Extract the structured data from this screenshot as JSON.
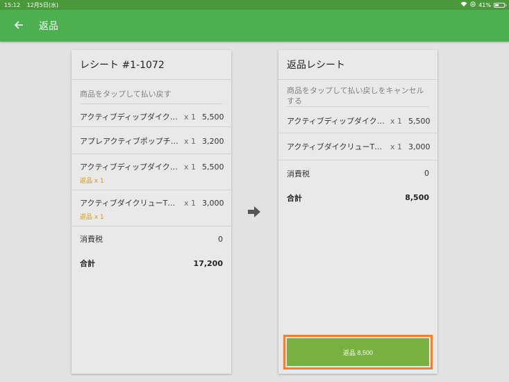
{
  "status_bar": {
    "time": "15:12",
    "date": "12月5日(水)",
    "battery": "41%",
    "battery_level": 0.41
  },
  "toolbar": {
    "title": "返品"
  },
  "receipt": {
    "title": "レシート #1-1072",
    "hint": "商品をタップして払い戻す",
    "items": [
      {
        "name": "アクティブディップダイクロス",
        "qty": "x 1",
        "price": "5,500",
        "returned": ""
      },
      {
        "name": "アプレアクティブポップチャーム",
        "qty": "x 1",
        "price": "3,200",
        "returned": ""
      },
      {
        "name": "アクティブディップダイクロス",
        "qty": "x 1",
        "price": "5,500",
        "returned": "返品 x 1"
      },
      {
        "name": "アクティブダイクリューTシャツ",
        "qty": "x 1",
        "price": "3,000",
        "returned": "返品 x 1"
      }
    ],
    "tax_label": "消費税",
    "tax_value": "0",
    "total_label": "合計",
    "total_value": "17,200"
  },
  "return_receipt": {
    "title": "返品レシート",
    "hint": "商品をタップして払い戻しをキャンセルする",
    "items": [
      {
        "name": "アクティブディップダイクロス",
        "qty": "x 1",
        "price": "5,500"
      },
      {
        "name": "アクティブダイクリューTシャツ",
        "qty": "x 1",
        "price": "3,000"
      }
    ],
    "tax_label": "消費税",
    "tax_value": "0",
    "total_label": "合計",
    "total_value": "8,500"
  },
  "return_button": {
    "label": "返品 8,500"
  },
  "colors": {
    "accent": "#4caf50",
    "button": "#79b140",
    "returned_text": "#d4950f",
    "highlight_border": "#f08030"
  }
}
